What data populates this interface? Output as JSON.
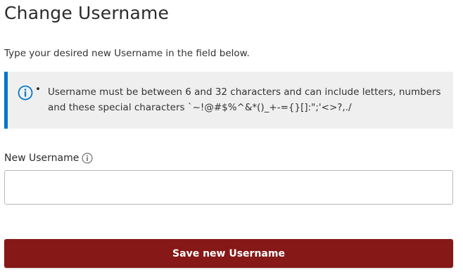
{
  "page": {
    "title": "Change Username",
    "intro": "Type your desired new Username in the field below."
  },
  "info_box": {
    "icon": "info-circle-icon",
    "bullet": "•",
    "text": "Username must be between 6 and 32 characters and can include letters, numbers and these special characters `~!@#$%^&*()_+-={}[]:\";'<>?,./",
    "accent_color": "#0077c8"
  },
  "form": {
    "label": "New Username",
    "label_icon": "info-circle-icon",
    "input_value": "",
    "input_placeholder": "",
    "save_label": "Save new Username",
    "button_color": "#861818"
  }
}
